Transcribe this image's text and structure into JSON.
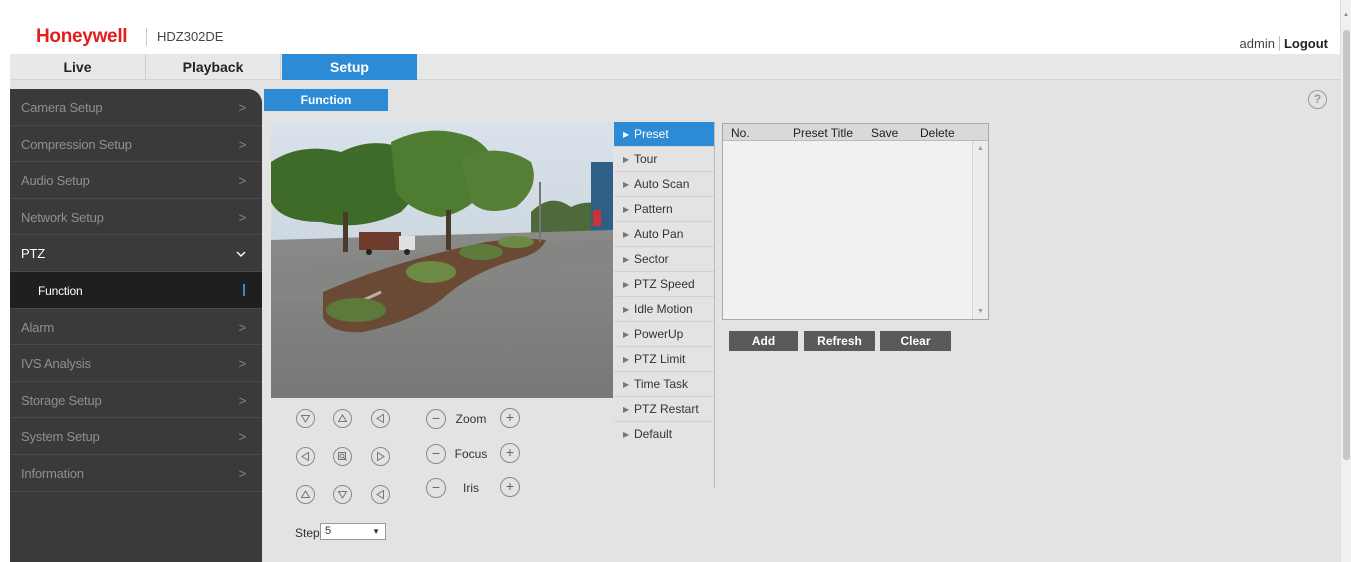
{
  "header": {
    "brand": "Honeywell",
    "model": "HDZ302DE",
    "user": "admin",
    "logout": "Logout"
  },
  "nav": {
    "tabs": [
      {
        "label": "Live"
      },
      {
        "label": "Playback"
      },
      {
        "label": "Setup",
        "active": true
      }
    ]
  },
  "sidebar": {
    "items": [
      {
        "label": "Camera Setup",
        "chev": ">"
      },
      {
        "label": "Compression Setup",
        "chev": ">"
      },
      {
        "label": "Audio Setup",
        "chev": ">"
      },
      {
        "label": "Network Setup",
        "chev": ">"
      },
      {
        "label": "PTZ",
        "chev": "v",
        "active": true
      },
      {
        "label": "Function",
        "sub": true
      },
      {
        "label": "Alarm",
        "chev": ">"
      },
      {
        "label": "IVS Analysis",
        "chev": ">"
      },
      {
        "label": "Storage Setup",
        "chev": ">"
      },
      {
        "label": "System Setup",
        "chev": ">"
      },
      {
        "label": "Information",
        "chev": ">"
      }
    ]
  },
  "content": {
    "tab": "Function",
    "help_icon": "?"
  },
  "ptz": {
    "zoom": "Zoom",
    "focus": "Focus",
    "iris": "Iris",
    "step_label": "Step",
    "step_value": "5",
    "minus": "−",
    "plus": "+"
  },
  "function_menu": {
    "items": [
      "Preset",
      "Tour",
      "Auto Scan",
      "Pattern",
      "Auto Pan",
      "Sector",
      "PTZ Speed",
      "Idle Motion",
      "PowerUp",
      "PTZ Limit",
      "Time Task",
      "PTZ Restart",
      "Default"
    ],
    "active_index": 0
  },
  "preset_table": {
    "headers": {
      "no": "No.",
      "title": "Preset Title",
      "save": "Save",
      "delete": "Delete"
    },
    "rows": []
  },
  "preset_buttons": {
    "add": "Add",
    "refresh": "Refresh",
    "clear": "Clear"
  },
  "colors": {
    "accent": "#2d8bd6",
    "brand": "#e1201d",
    "sidebar_bg": "#3a3a3a",
    "panel_bg": "#e3e3e3"
  }
}
